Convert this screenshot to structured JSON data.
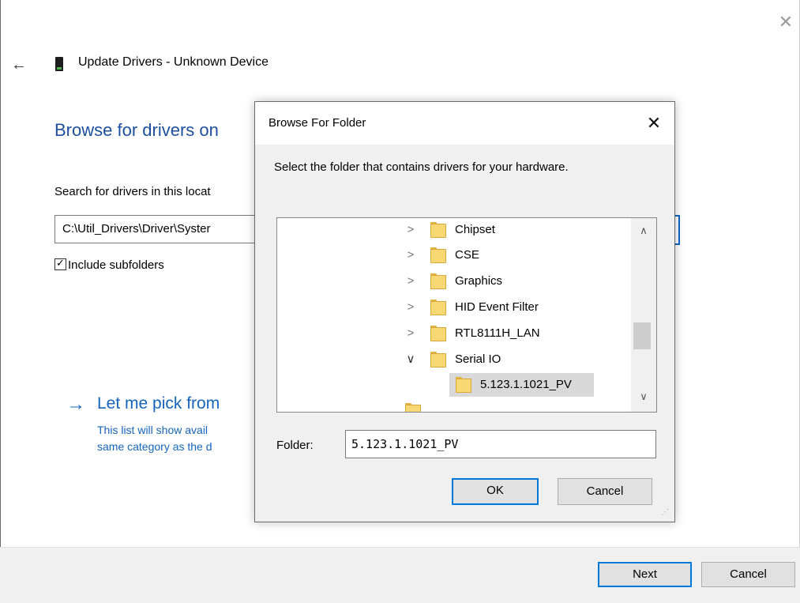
{
  "wizard": {
    "title": "Update Drivers - Unknown Device",
    "heading": "Browse for drivers on",
    "search_label": "Search for drivers in this locat",
    "path_value": "C:\\Util_Drivers\\Driver\\Syster",
    "include_subfolders_label": "Include subfolders",
    "include_subfolders_checked": true,
    "pick_title": "Let me pick from",
    "pick_desc_line1": "This list will show avail",
    "pick_desc_line2": "same category as the d",
    "next_label": "Next",
    "cancel_label": "Cancel",
    "close_glyph": "✕",
    "back_glyph": "←",
    "pick_arrow_glyph": "→",
    "accent_color": "#1565c0"
  },
  "dialog": {
    "title": "Browse For Folder",
    "close_glyph": "✕",
    "instruction": "Select the folder that contains drivers for your hardware.",
    "tree": [
      {
        "label": "Chipset",
        "expanded": false,
        "level": 1
      },
      {
        "label": "CSE",
        "expanded": false,
        "level": 1
      },
      {
        "label": "Graphics",
        "expanded": false,
        "level": 1
      },
      {
        "label": "HID Event Filter",
        "expanded": false,
        "level": 1
      },
      {
        "label": "RTL8111H_LAN",
        "expanded": false,
        "level": 1
      },
      {
        "label": "Serial IO",
        "expanded": true,
        "level": 1
      },
      {
        "label": "5.123.1.1021_PV",
        "expanded": null,
        "level": 2,
        "selected": true
      }
    ],
    "folder_label": "Folder:",
    "folder_value": "5.123.1.1021_PV",
    "ok_label": "OK",
    "cancel_label": "Cancel",
    "collapsed_glyph": ">",
    "expanded_glyph": "∨",
    "scroll_up_glyph": "∧",
    "scroll_down_glyph": "∨",
    "folder_color": "#f8d775"
  }
}
